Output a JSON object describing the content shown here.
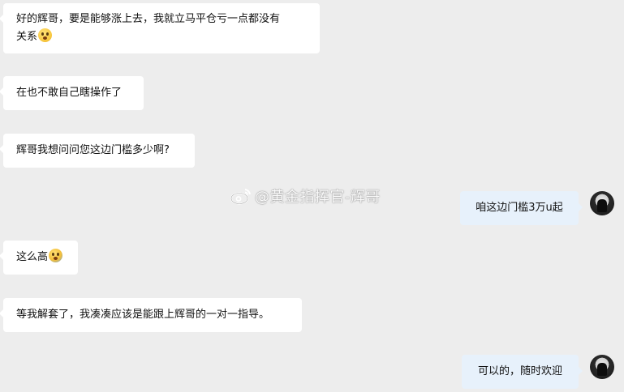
{
  "messages": [
    {
      "side": "left",
      "text_line1": "好的辉哥，要是能够涨上去，我就立马平仓亏一点都没有",
      "text_line2": "关系",
      "emoji": "astonished-face-emoji"
    },
    {
      "side": "left",
      "text": "在也不敢自己瞎操作了"
    },
    {
      "side": "left",
      "text": "辉哥我想问问您这边门槛多少啊?"
    },
    {
      "side": "right",
      "text": "咱这边门槛3万u起"
    },
    {
      "side": "left",
      "text": "这么高",
      "emoji": "screaming-face-emoji"
    },
    {
      "side": "left",
      "text": "等我解套了，我凑凑应该是能跟上辉哥的一对一指导。"
    },
    {
      "side": "right",
      "text": "可以的，随时欢迎"
    }
  ],
  "watermark": {
    "text": "@黄金指挥官-辉哥",
    "icon": "weibo-icon"
  },
  "colors": {
    "background": "#ededed",
    "left_bubble": "#ffffff",
    "right_bubble": "#e7f1fb",
    "text": "#111111"
  }
}
